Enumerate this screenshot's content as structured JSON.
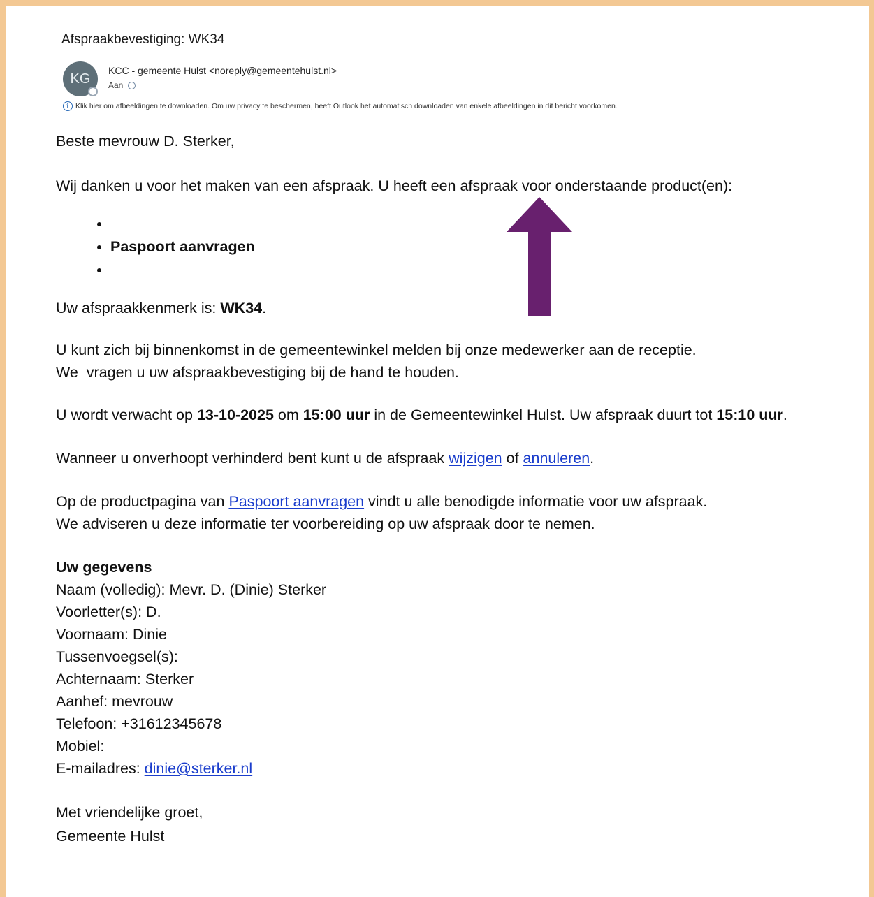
{
  "email": {
    "subject": "Afspraakbevestiging: WK34",
    "avatar_initials": "KG",
    "sender": "KCC - gemeente Hulst <noreply@gemeentehulst.nl>",
    "to_label": "Aan",
    "info_bar": "Klik hier om afbeeldingen te downloaden. Om uw privacy te beschermen, heeft Outlook het automatisch downloaden van enkele afbeeldingen in dit bericht voorkomen."
  },
  "body": {
    "greeting": "Beste mevrouw D. Sterker,",
    "thanks": "Wij danken u voor het maken van een afspraak. U heeft een afspraak voor onderstaande product(en):",
    "products": [
      "",
      "Paspoort aanvragen",
      ""
    ],
    "ref_prefix": "Uw afspraakkenmerk is: ",
    "ref_code": "WK34",
    "ref_suffix": ".",
    "report_line1": "U kunt zich bij binnenkomst in de gemeentewinkel melden bij onze medewerker aan de receptie.",
    "report_line2": "We  vragen u uw afspraakbevestiging bij de hand te houden.",
    "expect_prefix": "U wordt verwacht op ",
    "expect_date": "13-10-2025",
    "expect_om": " om ",
    "expect_time": "15:00 uur",
    "expect_mid": " in de Gemeentewinkel Hulst. Uw afspraak duurt tot ",
    "expect_end": "15:10 uur",
    "expect_suffix": ".",
    "change_prefix": "Wanneer u onverhoopt verhinderd bent kunt u de afspraak ",
    "change_link": "wijzigen",
    "change_of": " of ",
    "cancel_link": "annuleren",
    "change_suffix": ".",
    "product_prefix": "Op de productpagina van ",
    "product_link": "Paspoort aanvragen",
    "product_suffix": " vindt u alle benodigde informatie voor uw afspraak.",
    "advice": "We adviseren u deze informatie ter voorbereiding op uw afspraak door te nemen.",
    "details_heading": "Uw gegevens",
    "details": [
      "Naam (volledig): Mevr. D. (Dinie) Sterker",
      "Voorletter(s): D.",
      "Voornaam: Dinie",
      "Tussenvoegsel(s):",
      "Achternaam: Sterker",
      "Aanhef: mevrouw",
      "Telefoon: +31612345678",
      "Mobiel:"
    ],
    "email_label": "E-mailadres: ",
    "email_link": "dinie@sterker.nl",
    "closing": "Met vriendelijke groet,",
    "signature": "Gemeente Hulst"
  },
  "colors": {
    "frame_border": "#f3c893",
    "avatar": "#5e6f78",
    "link": "#1a3dcc",
    "arrow": "#68206e"
  },
  "icons": {
    "arrow": "arrow-up-icon",
    "info": "info-icon"
  }
}
